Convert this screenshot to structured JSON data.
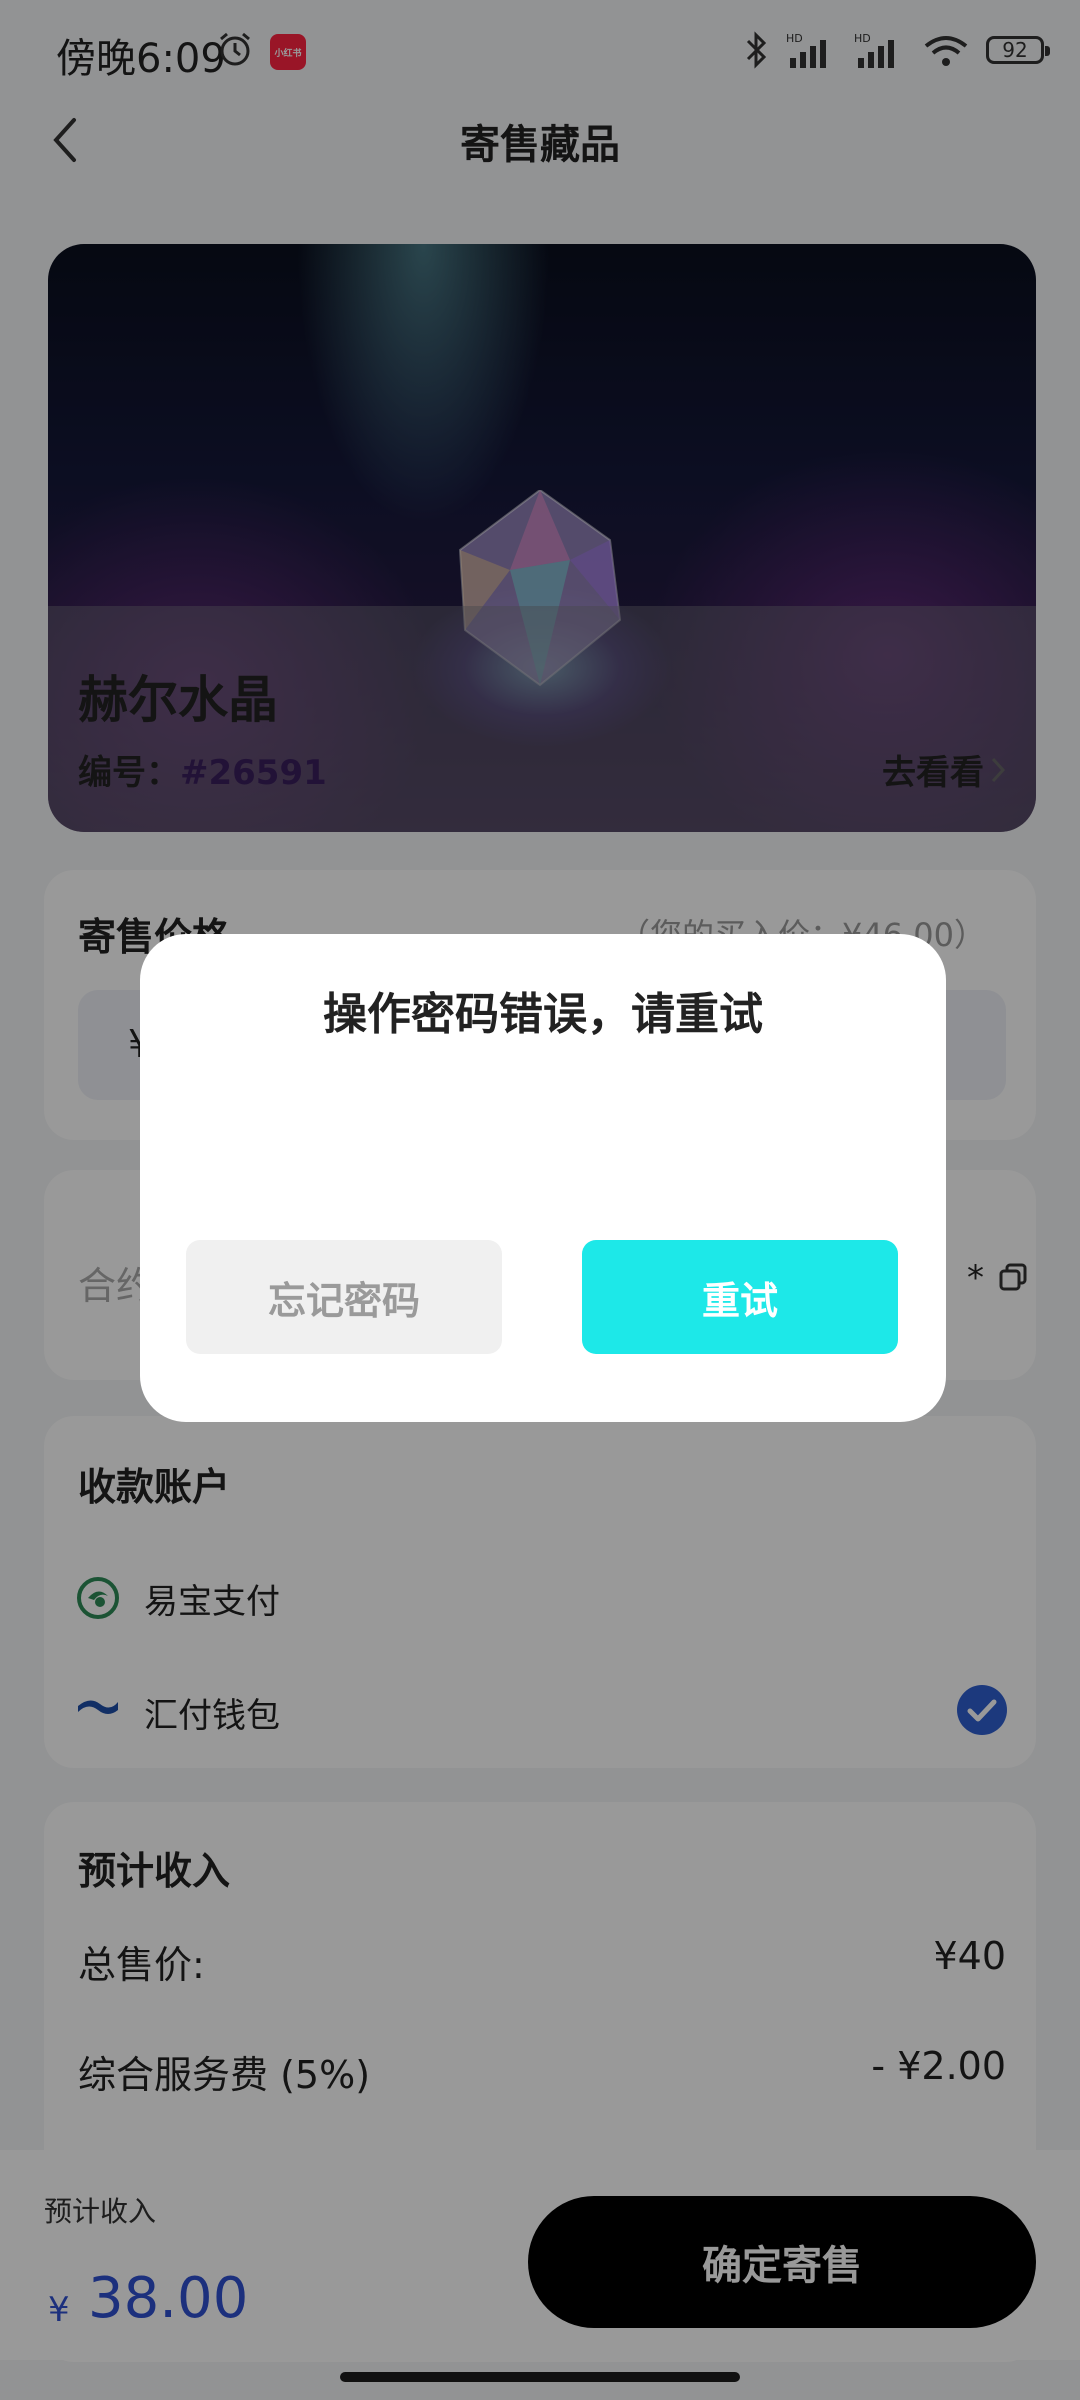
{
  "status_bar": {
    "time": "傍晚6:09",
    "app_badge": "小红书",
    "battery": "92"
  },
  "nav": {
    "title": "寄售藏品"
  },
  "collectible": {
    "name": "赫尔水晶",
    "number_label": "编号：",
    "number": "#26591",
    "view_link": "去看看"
  },
  "price": {
    "label": "寄售价格",
    "purchase_hint": "（您的买入价：¥46.00）",
    "currency": "¥"
  },
  "contract": {
    "label": "合约",
    "value": "*"
  },
  "account": {
    "label": "收款账户",
    "options": [
      {
        "label": "易宝支付",
        "selected": false
      },
      {
        "label": "汇付钱包",
        "selected": true
      }
    ],
    "accent": "#2f5fd0"
  },
  "income": {
    "label": "预计收入",
    "total_label": "总售价:",
    "total_value": "¥40",
    "fee_label": "综合服务费 (5%)",
    "fee_value": "- ¥2.00"
  },
  "bottom": {
    "estimate_label": "预计收入",
    "currency": "¥",
    "estimate_value": "38.00",
    "confirm_label": "确定寄售"
  },
  "dialog": {
    "title": "操作密码错误，请重试",
    "forgot_label": "忘记密码",
    "retry_label": "重试",
    "retry_color": "#1de8e8"
  }
}
